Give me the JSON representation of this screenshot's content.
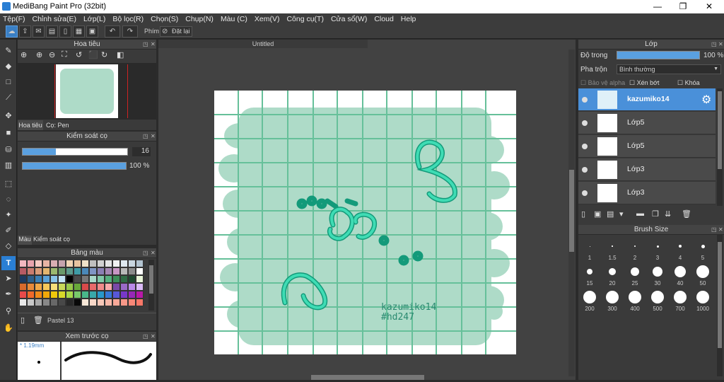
{
  "window": {
    "title": "MediBang Paint Pro (32bit)",
    "min": "—",
    "max": "❐",
    "close": "✕"
  },
  "menu": [
    "Tệp(F)",
    "Chỉnh sửa(E)",
    "Lớp(L)",
    "Bộ lọc(R)",
    "Chọn(S)",
    "Chụp(N)",
    "Màu (C)",
    "Xem(V)",
    "Công cụ(T)",
    "Cửa sổ(W)",
    "Cloud",
    "Help"
  ],
  "toolbar": {
    "shortcut_label": "Phím",
    "reset_label": "Đặt lại"
  },
  "navigator": {
    "title": "Hoa tiêu",
    "tabs": [
      "Hoa tiêu",
      "Cọ: Pen"
    ]
  },
  "brush_control": {
    "title": "Kiểm soát cọ",
    "size_value": "16",
    "opacity_value": "100 %",
    "size_fraction": 0.32,
    "opacity_fraction": 1.0
  },
  "color_tabs": [
    "Màu",
    "Kiểm soát cọ"
  ],
  "palette": {
    "title": "Bảng màu",
    "name": "Pastel 13",
    "colors": [
      "#f2b8c0",
      "#e9a3ad",
      "#f7c9c2",
      "#e8b4a4",
      "#d9aeb3",
      "#c6a3ad",
      "#f0d3b4",
      "#e7c3a0",
      "#efe2c8",
      "#bfbfbf",
      "#d0d0d0",
      "#e4e4e4",
      "#f1f1f1",
      "#dfe9f0",
      "#c9d6e0",
      "#b3c4d1",
      "#b75b64",
      "#c97c6f",
      "#d99b78",
      "#e3b56e",
      "#9bb86f",
      "#6a9a6a",
      "#5c9a8c",
      "#3f9ca6",
      "#4a88b8",
      "#7f95c4",
      "#8a7fb3",
      "#a587b3",
      "#c896c4",
      "#b8b8b8",
      "#8c8c8c",
      "#ffffff",
      "#1e3a5f",
      "#2d5f8a",
      "#3a7fb5",
      "#5aa2d8",
      "#89c4e8",
      "#c2e3f5",
      "#000000",
      "#4a4a4a",
      "#777777",
      "#a8d8c8",
      "#7fc8a8",
      "#56b07f",
      "#3e8e5a",
      "#2f6b45",
      "#1f4a30",
      "#e8f5d8",
      "#d86a2c",
      "#e88a3a",
      "#f0a848",
      "#f7c85a",
      "#f7e07a",
      "#c8d85a",
      "#98c84a",
      "#68a83a",
      "#d84a4a",
      "#e86a6a",
      "#f08a8a",
      "#f7aaaa",
      "#7a4aa8",
      "#9a6ac8",
      "#ba8ae8",
      "#dabaf7",
      "#e84a4a",
      "#f06a2a",
      "#f08a1a",
      "#f0a80a",
      "#f0c80a",
      "#d8d82a",
      "#a8d84a",
      "#78c86a",
      "#48b88a",
      "#38a8aa",
      "#2898ca",
      "#3878d8",
      "#5858d8",
      "#7838c8",
      "#9828b8",
      "#b818a8",
      "#e8e8e8",
      "#c8c8c8",
      "#a8a8a8",
      "#888888",
      "#686868",
      "#484848",
      "#282828",
      "#080808",
      "#f8e8d8",
      "#f8d8c8",
      "#f8c8b8",
      "#f8b8a8",
      "#f8a898",
      "#f89888",
      "#f88878",
      "#f87868"
    ]
  },
  "preview": {
    "title": "Xem trước cọ",
    "size_label": "* 1.19mm"
  },
  "canvas": {
    "tab": "Untitled",
    "brand": "kazumiko14",
    "tag": "#hd247"
  },
  "layers_panel": {
    "title": "Lớp",
    "opacity_label": "Độ trong",
    "opacity_value": "100 %",
    "opacity_fraction": 1.0,
    "blend_label": "Pha trộn",
    "blend_value": "Bình thường",
    "protect_alpha": "Bảo vệ alpha",
    "clip": "Xén bớt",
    "lock": "Khóa",
    "layers": [
      {
        "name": "kazumiko14",
        "active": true
      },
      {
        "name": "Lớp5",
        "active": false
      },
      {
        "name": "Lớp5",
        "active": false
      },
      {
        "name": "Lớp3",
        "active": false
      },
      {
        "name": "Lớp3",
        "active": false
      }
    ]
  },
  "brush_size_panel": {
    "title": "Brush Size",
    "sizes": [
      "1",
      "1.5",
      "2",
      "3",
      "4",
      "5",
      "15",
      "20",
      "25",
      "30",
      "40",
      "50",
      "200",
      "300",
      "400",
      "500",
      "700",
      "1000"
    ]
  }
}
